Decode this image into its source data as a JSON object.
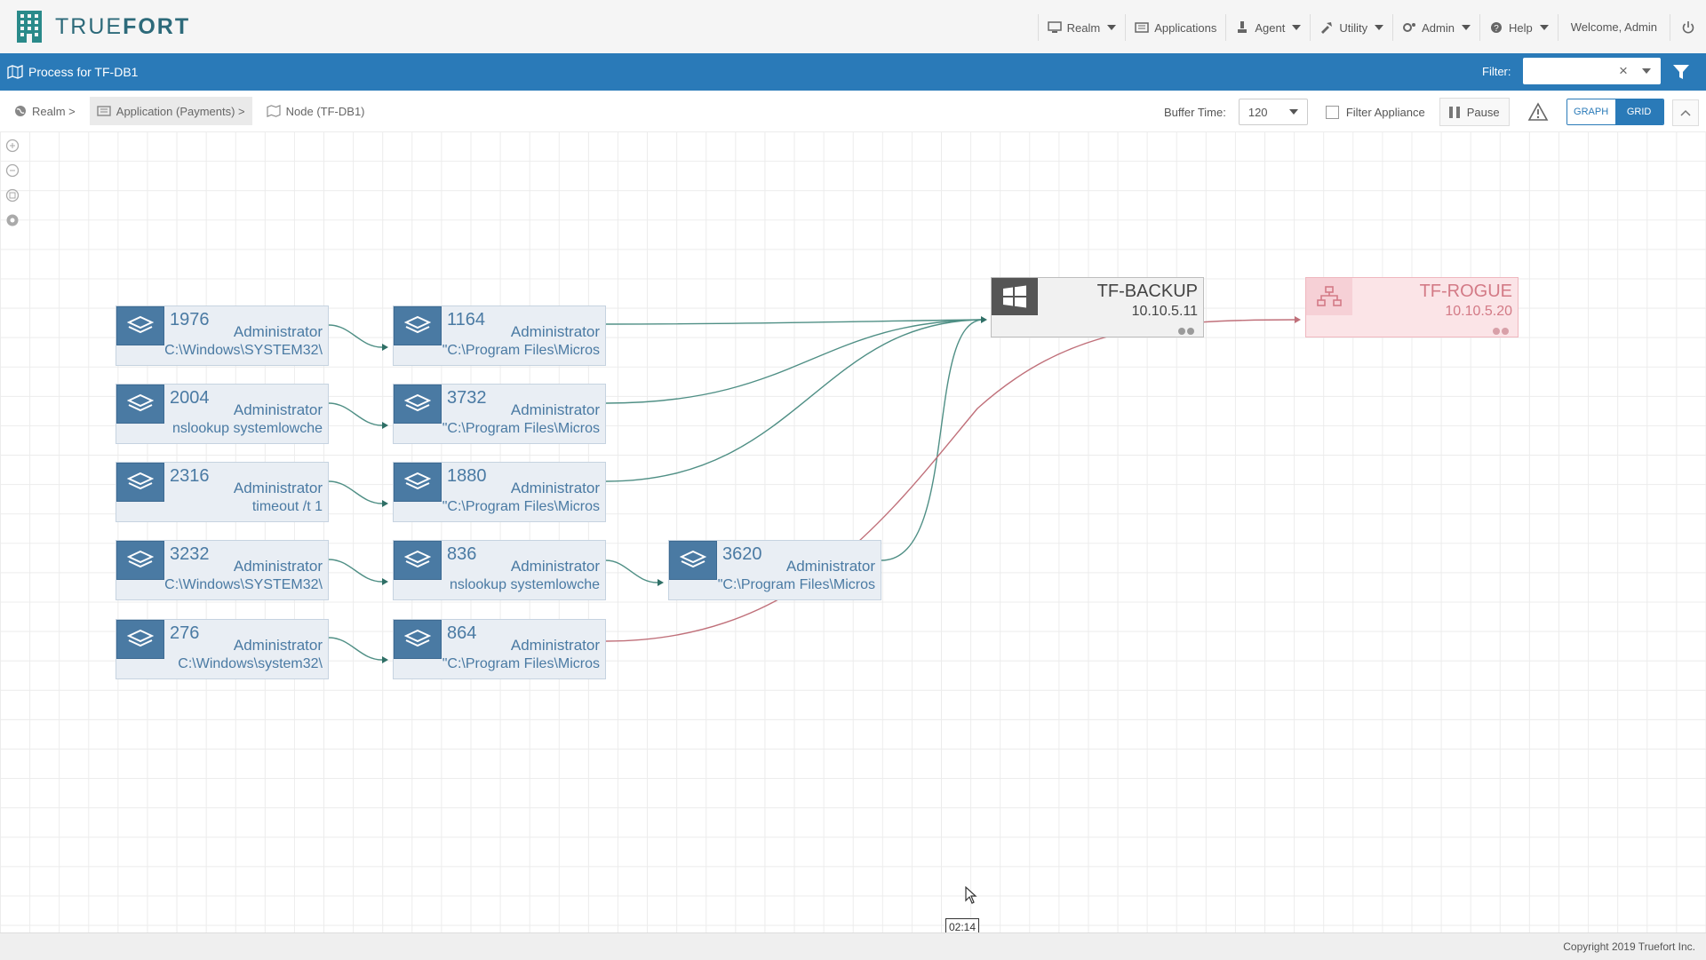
{
  "brand": {
    "text_light": "TRUE",
    "text_bold": "FORT"
  },
  "nav": {
    "items": [
      {
        "label": "Realm",
        "icon": "monitor-icon",
        "dropdown": true
      },
      {
        "label": "Applications",
        "icon": "applications-icon",
        "dropdown": false
      },
      {
        "label": "Agent",
        "icon": "agent-icon",
        "dropdown": true
      },
      {
        "label": "Utility",
        "icon": "utility-icon",
        "dropdown": true
      },
      {
        "label": "Admin",
        "icon": "admin-gear-icon",
        "dropdown": true
      },
      {
        "label": "Help",
        "icon": "help-icon",
        "dropdown": true
      }
    ],
    "welcome": "Welcome, Admin"
  },
  "page": {
    "title": "Process for TF-DB1",
    "filter_label": "Filter:",
    "filter_value": ""
  },
  "breadcrumb": [
    "Realm >",
    "Application (Payments) >",
    "Node (TF-DB1)"
  ],
  "controls": {
    "buffer_label": "Buffer Time:",
    "buffer_value": "120",
    "filter_appliance": "Filter Appliance",
    "pause": "Pause",
    "view_graph": "GRAPH",
    "view_grid": "GRID"
  },
  "processes": [
    {
      "pid": "1976",
      "user": "Administrator",
      "cmd": "C:\\Windows\\SYSTEM32\\"
    },
    {
      "pid": "1164",
      "user": "Administrator",
      "cmd": "\"C:\\Program Files\\Micros"
    },
    {
      "pid": "2004",
      "user": "Administrator",
      "cmd": "nslookup  systemlowche"
    },
    {
      "pid": "3732",
      "user": "Administrator",
      "cmd": "\"C:\\Program Files\\Micros"
    },
    {
      "pid": "2316",
      "user": "Administrator",
      "cmd": "timeout  /t 1"
    },
    {
      "pid": "1880",
      "user": "Administrator",
      "cmd": "\"C:\\Program Files\\Micros"
    },
    {
      "pid": "3232",
      "user": "Administrator",
      "cmd": "C:\\Windows\\SYSTEM32\\"
    },
    {
      "pid": "836",
      "user": "Administrator",
      "cmd": "nslookup  systemlowche"
    },
    {
      "pid": "3620",
      "user": "Administrator",
      "cmd": "\"C:\\Program Files\\Micros"
    },
    {
      "pid": "276",
      "user": "Administrator",
      "cmd": "C:\\Windows\\system32\\"
    },
    {
      "pid": "864",
      "user": "Administrator",
      "cmd": "\"C:\\Program Files\\Micros"
    }
  ],
  "hosts": [
    {
      "name": "TF-BACKUP",
      "ip": "10.10.5.11",
      "icon": "windows-icon",
      "color": "#444444"
    },
    {
      "name": "TF-ROGUE",
      "ip": "10.10.5.20",
      "icon": "network-icon",
      "color": "#d37a86"
    }
  ],
  "colors": {
    "accent": "#2a7ab8",
    "process": "#4a7aa3",
    "link_ok": "#4f8f85",
    "link_bad": "#c0707a"
  },
  "timeline_label": "02:14",
  "footer": "Copyright 2019 Truefort Inc."
}
